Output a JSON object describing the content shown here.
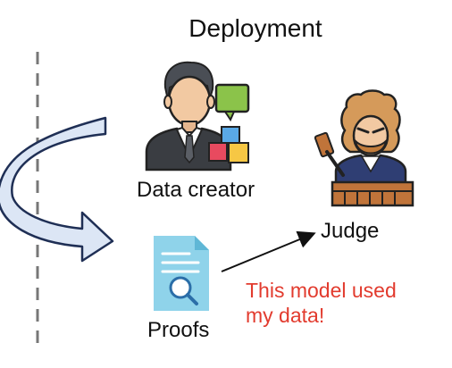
{
  "title": "Deployment",
  "nodes": {
    "data_creator": {
      "label": "Data creator",
      "icon": "businessman-with-data-blocks-icon"
    },
    "judge": {
      "label": "Judge",
      "icon": "judge-with-gavel-icon"
    },
    "proofs": {
      "label": "Proofs",
      "icon": "document-search-icon"
    }
  },
  "claim": {
    "line1": "This model used",
    "line2": "my data!"
  },
  "colors": {
    "claim_text": "#e23b2e",
    "curved_arrow_fill": "#dce6f5",
    "document": "#8fd3ea",
    "suit": "#3a3d42",
    "judge_robe": "#2f3e73",
    "speech_bubble": "#8bc34a"
  },
  "edges": [
    {
      "from": "proofs",
      "to": "judge",
      "style": "arrow"
    }
  ]
}
